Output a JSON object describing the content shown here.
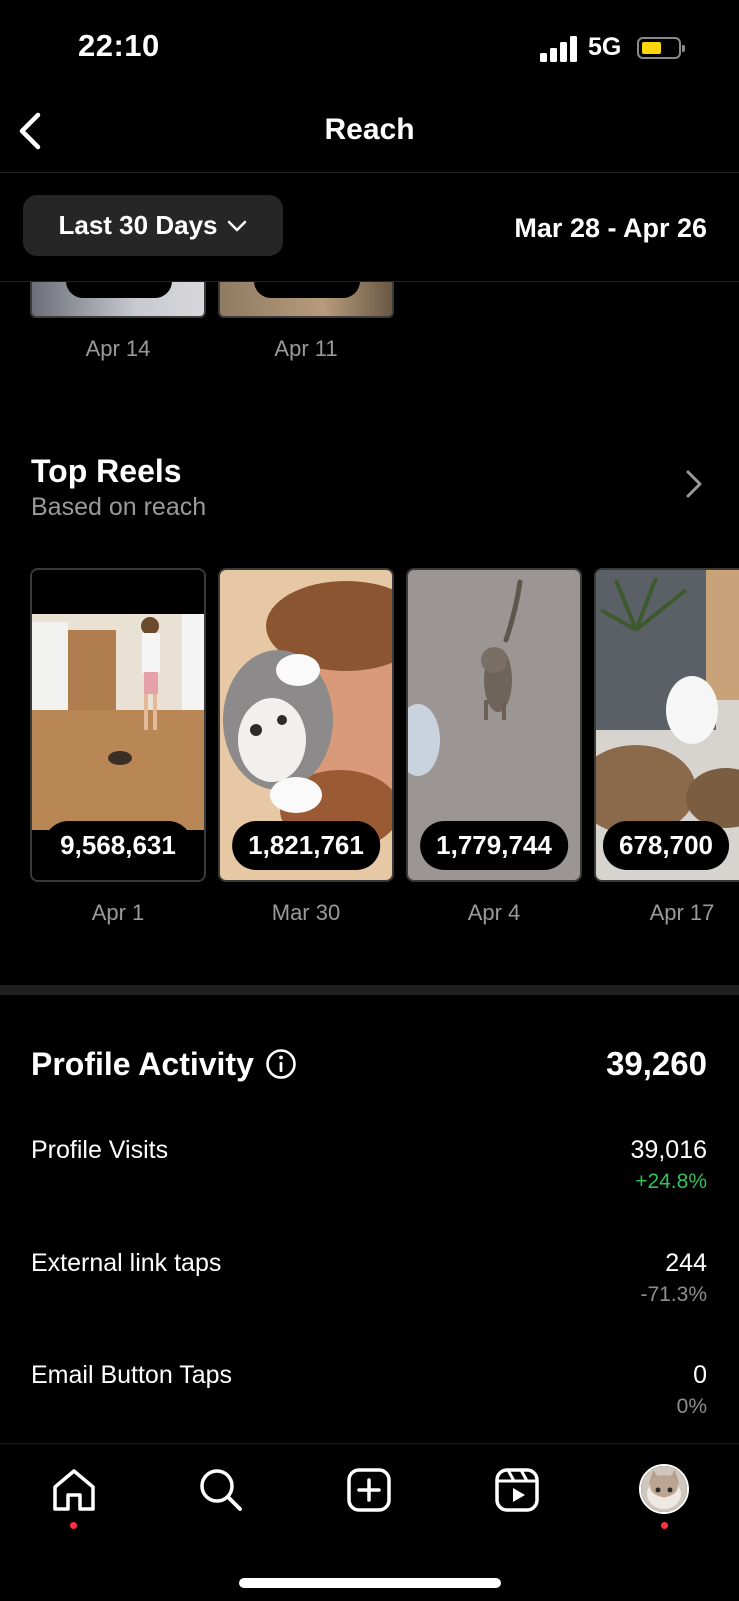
{
  "status_bar": {
    "time": "22:10",
    "network": "5G"
  },
  "header": {
    "title": "Reach"
  },
  "filter": {
    "range_label": "Last 30 Days",
    "date_range": "Mar 28 - Apr 26"
  },
  "top_posts_partial": [
    {
      "date": "Apr 14"
    },
    {
      "date": "Apr 11"
    }
  ],
  "top_reels": {
    "title": "Top Reels",
    "subtitle": "Based on reach",
    "items": [
      {
        "value": "9,568,631",
        "date": "Apr 1"
      },
      {
        "value": "1,821,761",
        "date": "Mar 30"
      },
      {
        "value": "1,779,744",
        "date": "Apr 4"
      },
      {
        "value": "678,700",
        "date": "Apr 17"
      }
    ]
  },
  "profile_activity": {
    "title": "Profile Activity",
    "total": "39,260",
    "rows": [
      {
        "label": "Profile Visits",
        "value": "39,016",
        "delta": "+24.8%"
      },
      {
        "label": "External link taps",
        "value": "244",
        "delta": "-71.3%"
      },
      {
        "label": "Email Button Taps",
        "value": "0",
        "delta": "0%"
      }
    ]
  },
  "colors": {
    "background": "#000000",
    "positive": "#2fc15a",
    "muted": "#9a9a9a",
    "notification": "#ff3040",
    "battery": "#ffd60a"
  },
  "tabbar_icons": [
    "home-icon",
    "search-icon",
    "create-icon",
    "reels-icon",
    "profile-avatar"
  ]
}
